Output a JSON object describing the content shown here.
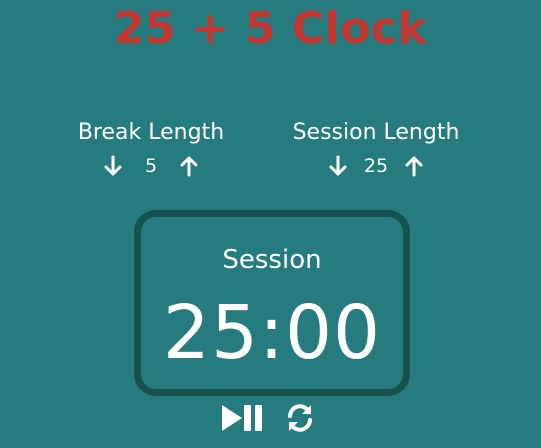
{
  "app": {
    "title": "25 + 5 Clock"
  },
  "break": {
    "label": "Break Length",
    "value": "5",
    "decrement_icon": "arrow-down-icon",
    "increment_icon": "arrow-up-icon"
  },
  "session": {
    "label": "Session Length",
    "value": "25",
    "decrement_icon": "arrow-down-icon",
    "increment_icon": "arrow-up-icon"
  },
  "timer": {
    "label": "Session",
    "time_left": "25:00"
  },
  "controls": {
    "play_pause_icon": "play-pause-icon",
    "reset_icon": "refresh-icon"
  },
  "colors": {
    "background": "#267b7e",
    "title": "#c4352f",
    "timer_border": "#17524f",
    "text": "#ffffff"
  }
}
